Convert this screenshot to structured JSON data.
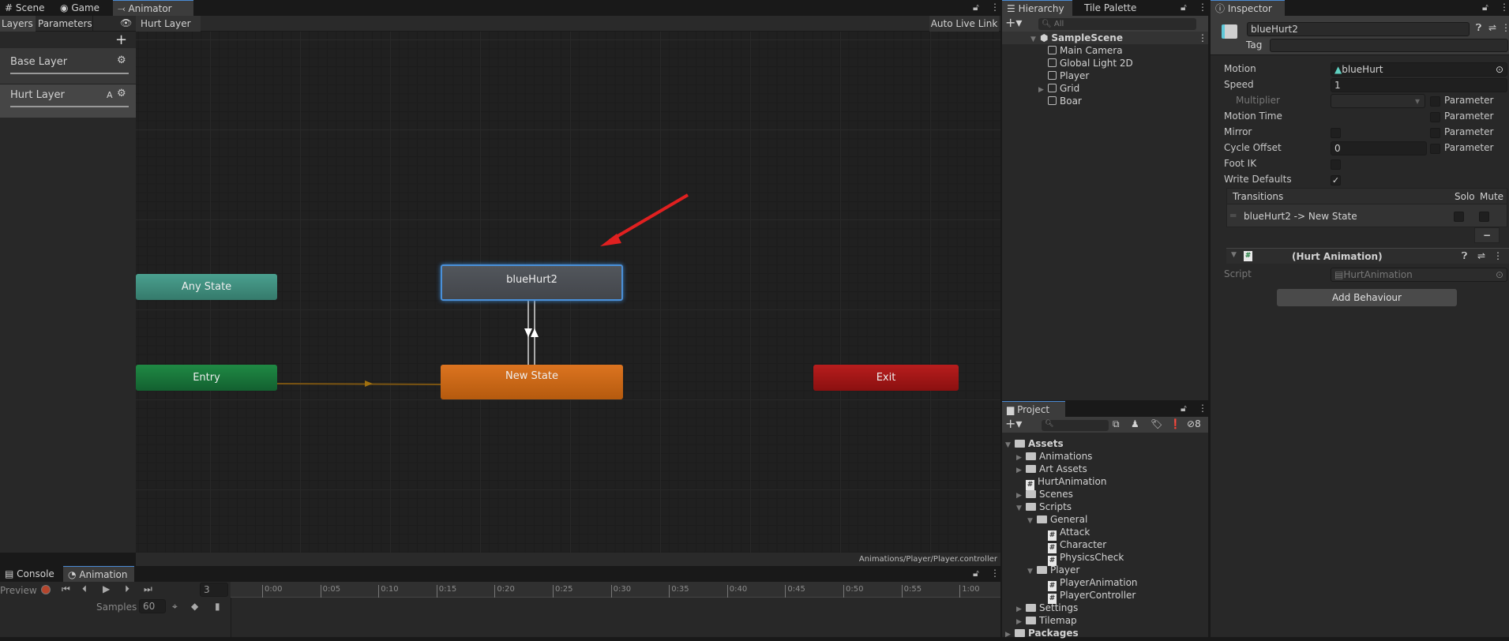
{
  "top_tabs": {
    "scene": "Scene",
    "game": "Game",
    "animator": "Animator"
  },
  "animator": {
    "layers_tab": "Layers",
    "parameters_tab": "Parameters",
    "breadcrumb": "Hurt Layer",
    "auto_live_link": "Auto Live Link",
    "add_layer": "+",
    "layers": [
      {
        "name": "Base Layer",
        "badge": ""
      },
      {
        "name": "Hurt Layer",
        "badge": "A"
      }
    ],
    "nodes": {
      "any_state": "Any State",
      "entry": "Entry",
      "exit": "Exit",
      "new_state": "New State",
      "selected_state": "blueHurt2"
    },
    "path": "Animations/Player/Player.controller",
    "colors": {
      "any_state": "#3f8f80",
      "entry": "#1a7a3a",
      "exit": "#a51818",
      "default_state": "#d26c14",
      "state": "#4a4d52",
      "selection": "#4a90d9",
      "annotation_arrow": "#e02020"
    }
  },
  "hierarchy": {
    "tab": "Hierarchy",
    "tab2": "Tile Palette",
    "search_placeholder": "All",
    "scene": "SampleScene",
    "items": [
      {
        "name": "Main Camera",
        "expandable": false
      },
      {
        "name": "Global Light 2D",
        "expandable": false
      },
      {
        "name": "Player",
        "expandable": false
      },
      {
        "name": "Grid",
        "expandable": true
      },
      {
        "name": "Boar",
        "expandable": false
      }
    ]
  },
  "project": {
    "tab": "Project",
    "hidden_count": "8",
    "tree": [
      {
        "name": "Assets",
        "level": 0,
        "type": "folder",
        "state": "open",
        "bold": true
      },
      {
        "name": "Animations",
        "level": 1,
        "type": "folder",
        "state": "closed"
      },
      {
        "name": "Art Assets",
        "level": 1,
        "type": "folder",
        "state": "closed"
      },
      {
        "name": "HurtAnimation",
        "level": 1,
        "type": "script",
        "state": "none"
      },
      {
        "name": "Scenes",
        "level": 1,
        "type": "folder",
        "state": "closed"
      },
      {
        "name": "Scripts",
        "level": 1,
        "type": "folder",
        "state": "open"
      },
      {
        "name": "General",
        "level": 2,
        "type": "folder",
        "state": "open"
      },
      {
        "name": "Attack",
        "level": 3,
        "type": "script",
        "state": "none"
      },
      {
        "name": "Character",
        "level": 3,
        "type": "script",
        "state": "none"
      },
      {
        "name": "PhysicsCheck",
        "level": 3,
        "type": "script",
        "state": "none"
      },
      {
        "name": "Player",
        "level": 2,
        "type": "folder",
        "state": "open"
      },
      {
        "name": "PlayerAnimation",
        "level": 3,
        "type": "script",
        "state": "none"
      },
      {
        "name": "PlayerController",
        "level": 3,
        "type": "script",
        "state": "none"
      },
      {
        "name": "Settings",
        "level": 1,
        "type": "folder",
        "state": "closed"
      },
      {
        "name": "Tilemap",
        "level": 1,
        "type": "folder",
        "state": "closed"
      },
      {
        "name": "Packages",
        "level": 0,
        "type": "folder",
        "state": "closed",
        "bold": true
      }
    ]
  },
  "inspector": {
    "tab": "Inspector",
    "name": "blueHurt2",
    "tag_label": "Tag",
    "motion_label": "Motion",
    "motion_value": "blueHurt",
    "speed_label": "Speed",
    "speed_value": "1",
    "multiplier_label": "Multiplier",
    "motion_time_label": "Motion Time",
    "mirror_label": "Mirror",
    "cycle_offset_label": "Cycle Offset",
    "cycle_offset_value": "0",
    "foot_ik_label": "Foot IK",
    "write_defaults_label": "Write Defaults",
    "write_defaults": true,
    "mirror": false,
    "foot_ik": false,
    "parameter_label": "Parameter",
    "transitions_label": "Transitions",
    "solo_label": "Solo",
    "mute_label": "Mute",
    "transition_item": "blueHurt2 -> New State",
    "remove_label": "−",
    "behaviour_title": "(Hurt Animation)",
    "script_label": "Script",
    "script_value": "HurtAnimation",
    "add_behaviour": "Add Behaviour"
  },
  "bottom": {
    "console_tab": "Console",
    "animation_tab": "Animation",
    "preview_label": "Preview",
    "frame": "3",
    "samples_label": "Samples",
    "samples_value": "60",
    "ticks": [
      "0:00",
      "0:05",
      "0:10",
      "0:15",
      "0:20",
      "0:25",
      "0:30",
      "0:35",
      "0:40",
      "0:45",
      "0:50",
      "0:55",
      "1:00"
    ]
  }
}
